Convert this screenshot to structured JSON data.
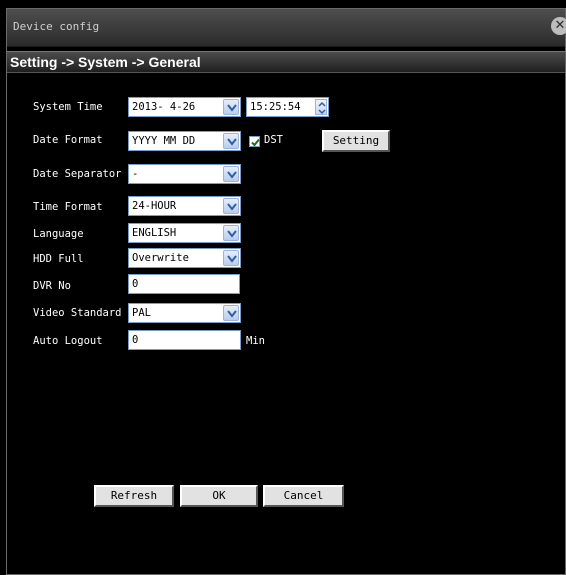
{
  "window": {
    "title": "Device config"
  },
  "breadcrumb": "Setting -> System -> General",
  "labels": {
    "system_time": "System Time",
    "date_format": "Date Format",
    "date_separator": "Date Separator",
    "time_format": "Time Format",
    "language": "Language",
    "hdd_full": "HDD Full",
    "dvr_no": "DVR No",
    "video_standard": "Video Standard",
    "auto_logout": "Auto Logout"
  },
  "values": {
    "date": "2013- 4-26",
    "time": "15:25:54",
    "date_format": "YYYY MM DD",
    "date_separator": "-",
    "time_format": "24-HOUR",
    "language": "ENGLISH",
    "hdd_full": "Overwrite",
    "dvr_no": "0",
    "video_standard": "PAL",
    "auto_logout": "0"
  },
  "dst": {
    "label": "DST",
    "checked": true
  },
  "units": {
    "auto_logout": "Min"
  },
  "buttons": {
    "setting": "Setting",
    "refresh": "Refresh",
    "ok": "OK",
    "cancel": "Cancel"
  },
  "icons": {
    "close": "close-icon",
    "dropdown": "chevron-down-icon",
    "spinner": "spinner-icon",
    "checkmark": "checkmark-icon"
  }
}
